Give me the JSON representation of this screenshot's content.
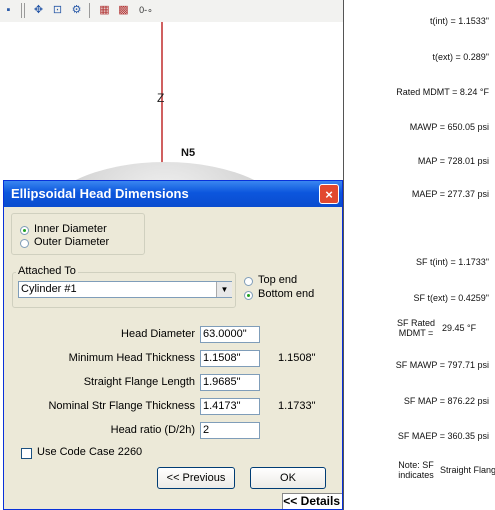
{
  "toolbar": {
    "icons": [
      "panel-icon",
      "pan-move-icon",
      "frame-icon",
      "gear-icon",
      "data-table-icon",
      "nozzle-table-icon",
      "orientation-icon"
    ],
    "glyphs": [
      "▪",
      "✥",
      "⊡",
      "⚙",
      "▦",
      "▩",
      "0-∘"
    ]
  },
  "view": {
    "axis_label": "Z",
    "nozzle_label": "N5"
  },
  "dialog": {
    "title": "Ellipsoidal Head Dimensions",
    "close_glyph": "×",
    "diameter_options": [
      "Inner Diameter",
      "Outer Diameter"
    ],
    "diameter_selected": "Inner Diameter",
    "attached_to_label": "Attached To",
    "attached_to_value": "Cylinder #1",
    "end_options": [
      "Top end",
      "Bottom end"
    ],
    "end_selected": "Bottom end",
    "fields": {
      "head_diameter_label": "Head Diameter",
      "head_diameter_value": "63.0000\"",
      "min_thickness_label": "Minimum Head Thickness",
      "min_thickness_value": "1.1508\"",
      "min_thickness_calc": "1.1508\"",
      "straight_flange_label": "Straight Flange Length",
      "straight_flange_value": "1.9685\"",
      "nominal_sf_label": "Nominal Str Flange Thickness",
      "nominal_sf_value": "1.4173\"",
      "nominal_sf_calc": "1.1733\"",
      "head_ratio_label": "Head ratio (D/2h)",
      "head_ratio_value": "2"
    },
    "code_case_label": "Use Code Case 2260",
    "code_case_checked": false,
    "previous_label": "<< Previous",
    "ok_label": "OK",
    "details_label": "<< Details"
  },
  "results": {
    "tint": "t(int) = 1.1533\"",
    "text": "t(ext) = 0.289\"",
    "rated_mdmt": "Rated MDMT = 8.24 °F",
    "mawp": "MAWP = 650.05 psi",
    "map": "MAP = 728.01 psi",
    "maep": "MAEP = 277.37 psi",
    "sf_tint": "SF t(int) = 1.1733\"",
    "sf_text": "SF t(ext) = 0.4259\"",
    "sf_rated_label_1": "SF Rated",
    "sf_rated_label_2": "MDMT =",
    "sf_rated_value": "29.45 °F",
    "sf_mawp": "SF MAWP = 797.71 psi",
    "sf_map": "SF MAP = 876.22 psi",
    "sf_maep": "SF MAEP = 360.35 psi",
    "note_label_1": "Note: SF",
    "note_label_2": "indicates",
    "note_value": "Straight Flange"
  }
}
